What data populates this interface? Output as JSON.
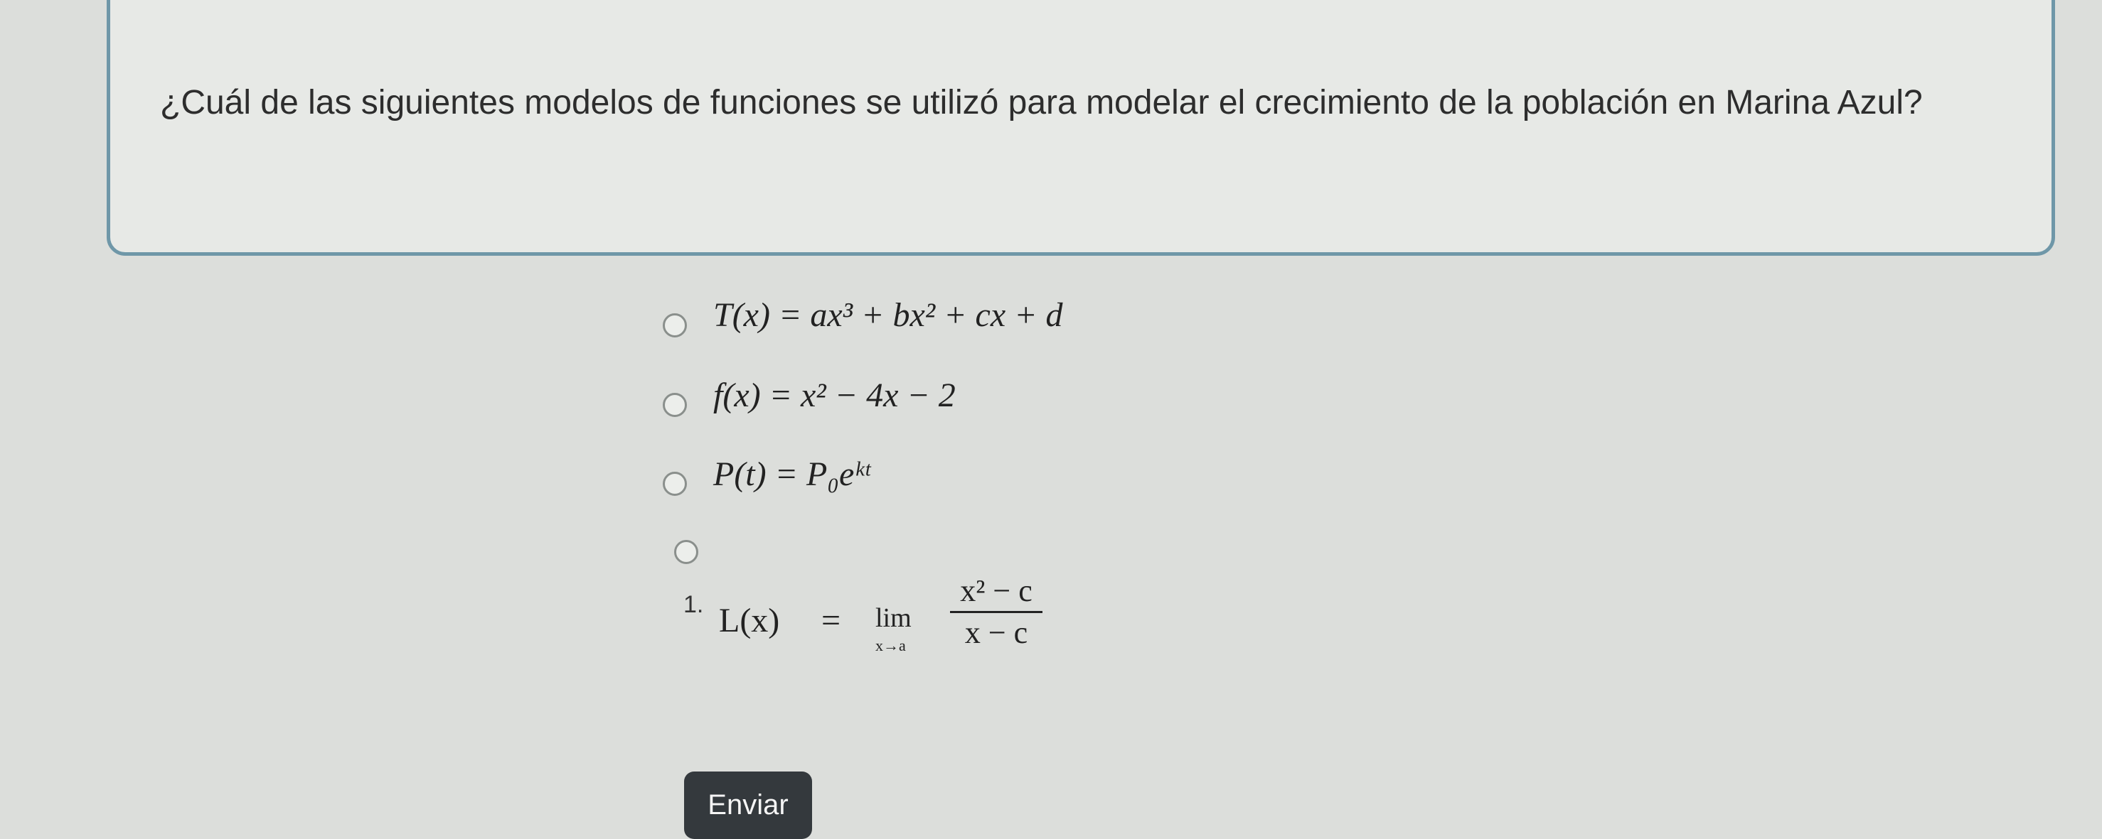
{
  "question": {
    "text": "¿Cuál de las siguientes modelos de funciones se utilizó para modelar el crecimiento de la población en Marina Azul?"
  },
  "options": [
    {
      "formula": "T(x) = ax³ + bx² + cx + d"
    },
    {
      "formula": "f(x) = x² − 4x − 2"
    },
    {
      "formula": "P(t) = P₀eᵏᵗ"
    },
    {
      "number": "1.",
      "lhs": "L(x)",
      "equals": "=",
      "lim": "lim",
      "sub": "x→a",
      "numerator": "x² − c",
      "denominator": "x − c"
    }
  ],
  "submit": {
    "label": "Enviar"
  },
  "colors": {
    "card_border": "#6f97a8",
    "button": "#34393d",
    "accent_dot": "#2f78d8"
  },
  "icons": {
    "radio": "radio-button-icon"
  }
}
